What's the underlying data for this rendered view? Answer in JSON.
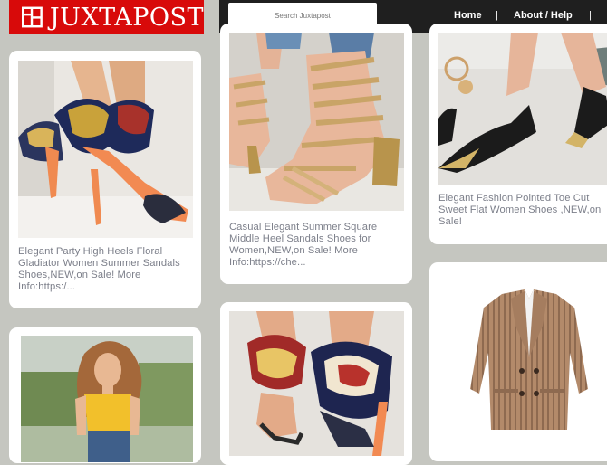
{
  "brand": {
    "name": "JUXTAPOST",
    "color": "#d80a0a"
  },
  "search": {
    "placeholder": "Search Juxtapost"
  },
  "nav": {
    "home": "Home",
    "separator": "|",
    "about": "About / Help",
    "more": "|"
  },
  "icons": {
    "logo": "grid-square-logo-icon"
  },
  "cards": [
    {
      "image": "heels-floral-ribbon-photo",
      "text": "Elegant Party High Heels Floral Gladiator Women Summer Sandals Shoes,NEW,on Sale! More Info:https:/..."
    },
    {
      "image": "gold-square-heel-sandals-photo",
      "text": "Casual Elegant Summer Square Middle Heel Sandals Shoes for Women,NEW,on Sale! More Info:https://che..."
    },
    {
      "image": "pointed-toe-flats-photo",
      "text": "Elegant Fashion Pointed Toe Cut Sweet Flat Women Shoes ,NEW,on Sale!"
    },
    {
      "image": "woman-yellow-top-photo",
      "text": ""
    },
    {
      "image": "scarf-ankle-heels-photo",
      "text": ""
    },
    {
      "image": "striped-blazer-photo",
      "text": ""
    }
  ]
}
